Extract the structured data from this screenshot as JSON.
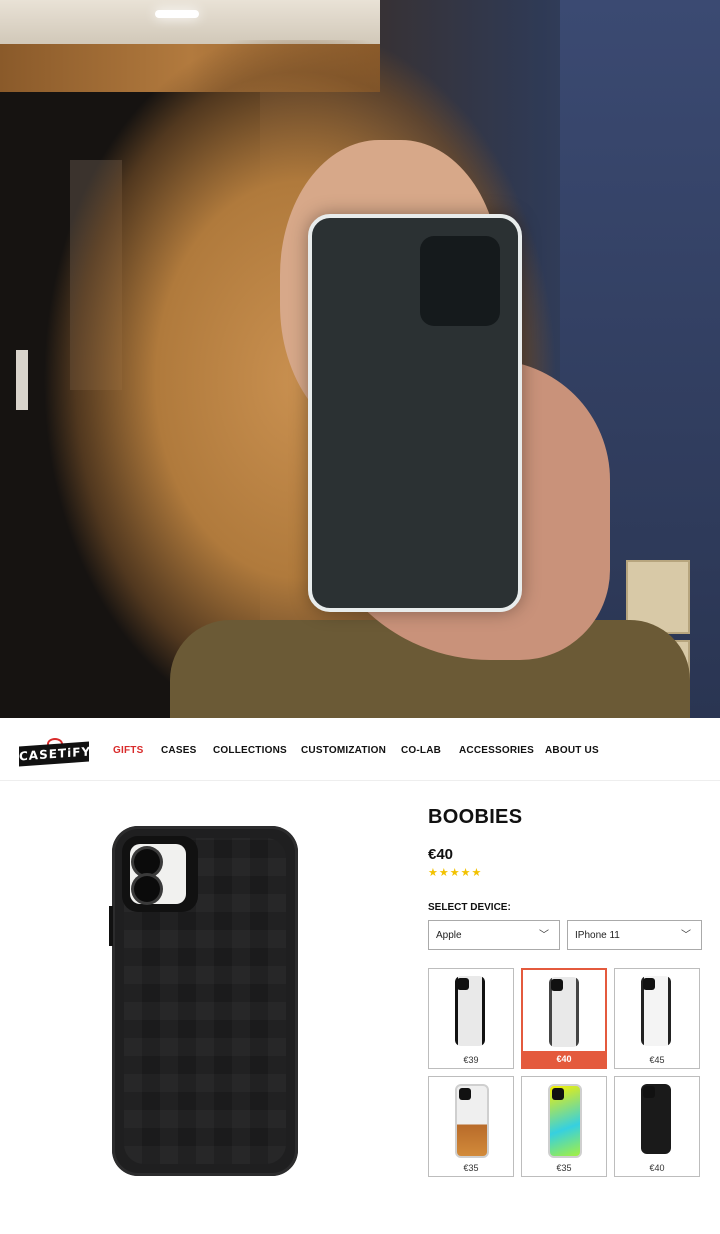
{
  "nav": {
    "logo": "CASETiFY",
    "links": [
      "GIFTS",
      "CASES",
      "COLLECTIONS",
      "CUSTOMIZATION",
      "CO-LAB",
      "ACCESSORIES",
      "ABOUT US"
    ],
    "active_link": "GIFTS"
  },
  "product": {
    "name": "BOOBIES",
    "price": "€40",
    "stars": "★★★★★",
    "rating": 5
  },
  "device": {
    "label": "SELECT DEVICE:",
    "brand": "Apple",
    "model": "IPhone 11"
  },
  "case_options": [
    {
      "price": "€39",
      "style": "clear-black",
      "selected": false
    },
    {
      "price": "€40",
      "style": "clear-grey",
      "selected": true
    },
    {
      "price": "€45",
      "style": "clear-white",
      "selected": false
    },
    {
      "price": "€35",
      "style": "glitter-gold",
      "selected": false
    },
    {
      "price": "€35",
      "style": "neon-sand",
      "selected": false
    },
    {
      "price": "€40",
      "style": "solid-black",
      "selected": false
    }
  ],
  "icons": {
    "dropdown": "chevron-down-icon",
    "gift": "gift-bow-icon",
    "rating": "star-icon"
  },
  "colors": {
    "accent": "#d92b2b",
    "selected_tile": "#e45a3d",
    "stars": "#f2c200"
  }
}
